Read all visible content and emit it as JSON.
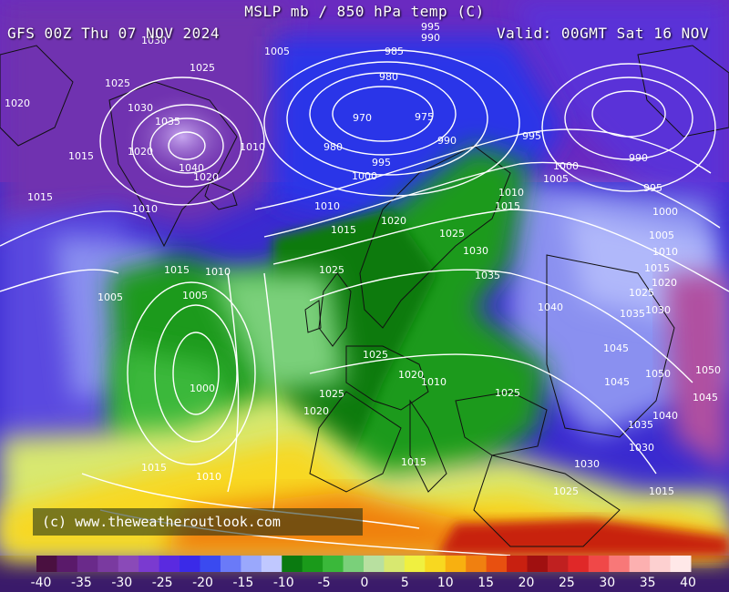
{
  "header": {
    "title": "MSLP mb / 850 hPa temp (C)",
    "run": "GFS 00Z Thu 07 NOV 2024",
    "valid": "Valid: 00GMT Sat 16 NOV"
  },
  "copyright": "(c) www.theweatheroutlook.com",
  "color_scale": {
    "min": -40,
    "max": 40,
    "tick_labels": [
      "-40",
      "-35",
      "-30",
      "-25",
      "-20",
      "-15",
      "-10",
      "-5",
      "0",
      "5",
      "10",
      "15",
      "20",
      "25",
      "30",
      "35",
      "40"
    ],
    "colors": [
      "#4a1040",
      "#5a1a6a",
      "#6a2a8a",
      "#7a3aa0",
      "#8a4ab8",
      "#7a3ad0",
      "#5a2ae0",
      "#3a2ae8",
      "#3a4af0",
      "#6a7af8",
      "#9aa8fc",
      "#c0c8ff",
      "#0a7a10",
      "#1a9a1a",
      "#3ab83a",
      "#7ad07a",
      "#b8e0a0",
      "#d8e870",
      "#f0f040",
      "#f8d820",
      "#f8b010",
      "#f08010",
      "#e85010",
      "#c82010",
      "#a01010",
      "#c02020",
      "#e02828",
      "#f04848",
      "#f87878",
      "#fcb0b0",
      "#fdd0d0",
      "#ffe8e8"
    ]
  },
  "isobar_labels": [
    {
      "t": "985"
    },
    {
      "t": "995"
    },
    {
      "t": "990"
    },
    {
      "t": "1005"
    },
    {
      "t": "980"
    },
    {
      "t": "970"
    },
    {
      "t": "975"
    },
    {
      "t": "980"
    },
    {
      "t": "1030"
    },
    {
      "t": "1025"
    },
    {
      "t": "1025"
    },
    {
      "t": "1020"
    },
    {
      "t": "1030"
    },
    {
      "t": "1035"
    },
    {
      "t": "1020"
    },
    {
      "t": "1040"
    },
    {
      "t": "1010"
    },
    {
      "t": "1020"
    },
    {
      "t": "1015"
    },
    {
      "t": "1015"
    },
    {
      "t": "990"
    },
    {
      "t": "995"
    },
    {
      "t": "990"
    },
    {
      "t": "1000"
    },
    {
      "t": "995"
    },
    {
      "t": "1000"
    },
    {
      "t": "1005"
    },
    {
      "t": "995"
    },
    {
      "t": "1010"
    },
    {
      "t": "1010"
    },
    {
      "t": "1015"
    },
    {
      "t": "1020"
    },
    {
      "t": "1000"
    },
    {
      "t": "1005"
    },
    {
      "t": "1010"
    },
    {
      "t": "1015"
    },
    {
      "t": "1025"
    },
    {
      "t": "1030"
    },
    {
      "t": "1035"
    },
    {
      "t": "1040"
    },
    {
      "t": "1015"
    },
    {
      "t": "1010"
    },
    {
      "t": "1005"
    },
    {
      "t": "1015"
    },
    {
      "t": "1025"
    },
    {
      "t": "1010"
    },
    {
      "t": "1005"
    },
    {
      "t": "1025"
    },
    {
      "t": "1035"
    },
    {
      "t": "1030"
    },
    {
      "t": "1025"
    },
    {
      "t": "1020"
    },
    {
      "t": "1045"
    },
    {
      "t": "1050"
    },
    {
      "t": "1045"
    },
    {
      "t": "1050"
    },
    {
      "t": "1000"
    },
    {
      "t": "1025"
    },
    {
      "t": "1020"
    },
    {
      "t": "1010"
    },
    {
      "t": "1025"
    },
    {
      "t": "1015"
    },
    {
      "t": "1030"
    },
    {
      "t": "1020"
    },
    {
      "t": "1025"
    },
    {
      "t": "1015"
    },
    {
      "t": "1010"
    },
    {
      "t": "1040"
    },
    {
      "t": "1035"
    },
    {
      "t": "1030"
    },
    {
      "t": "1015"
    },
    {
      "t": "1045"
    }
  ]
}
